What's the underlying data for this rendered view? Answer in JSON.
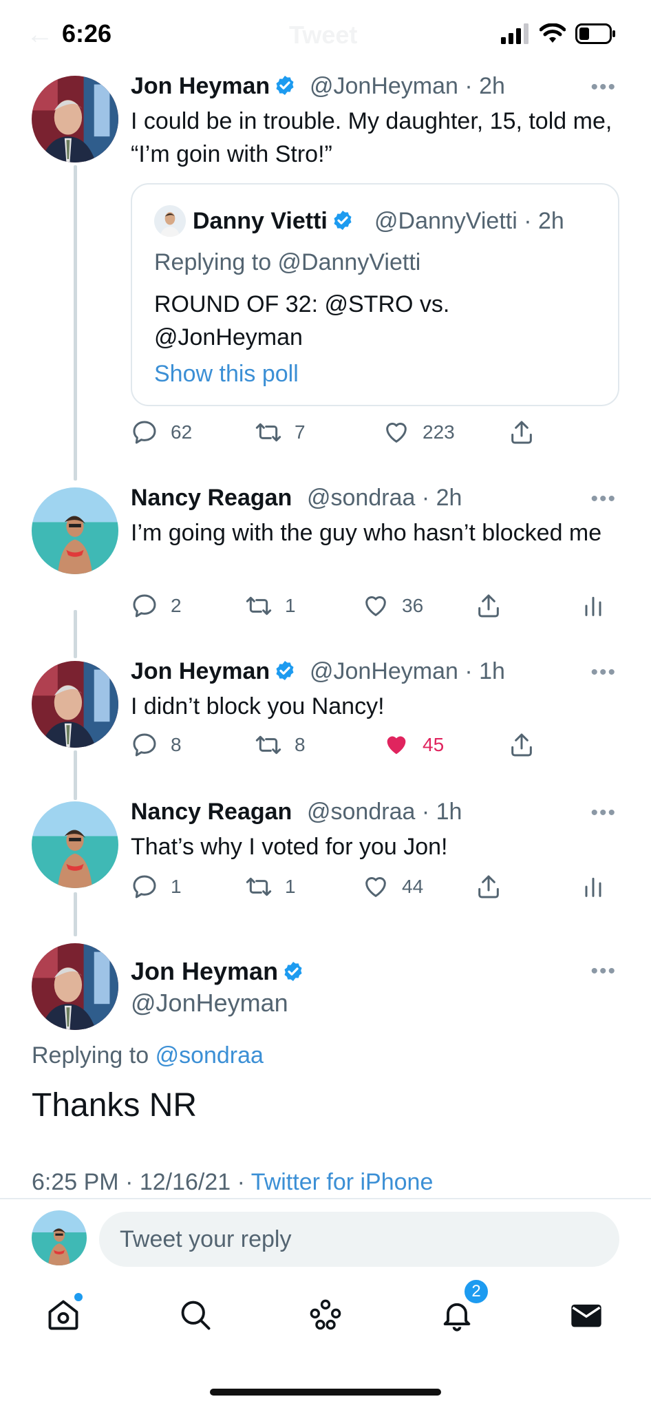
{
  "status_bar": {
    "time": "6:26",
    "ghost_title": "Tweet"
  },
  "tweets": [
    {
      "name": "Jon Heyman",
      "handle_time": "@JonHeyman · 2h",
      "text": "I could be in trouble. My daughter, 15, told me, “I’m goin with Stro!”",
      "quote": {
        "name": "Danny Vietti",
        "handle_time": "@DannyVietti · 2h",
        "replying_to": "Replying to @DannyVietti",
        "text": "ROUND OF 32: @STRO vs. @JonHeyman",
        "link": "Show this poll"
      },
      "replies": "62",
      "retweets": "7",
      "likes": "223"
    },
    {
      "name": "Nancy Reagan",
      "handle_time": "@sondraa · 2h",
      "text": "I’m going with the guy who hasn’t blocked me",
      "replies": "2",
      "retweets": "1",
      "likes": "36"
    },
    {
      "name": "Jon Heyman",
      "handle_time": "@JonHeyman · 1h",
      "text": "I didn’t block you Nancy!",
      "replies": "8",
      "retweets": "8",
      "likes": "45"
    },
    {
      "name": "Nancy Reagan",
      "handle_time": "@sondraa · 1h",
      "text": "That’s why I voted for you Jon!",
      "replies": "1",
      "retweets": "1",
      "likes": "44"
    }
  ],
  "main_tweet": {
    "name": "Jon Heyman",
    "handle": "@JonHeyman",
    "replying_label": "Replying to",
    "replying_mention": "@sondraa",
    "text": "Thanks NR",
    "timestamp": "6:25 PM · 12/16/21 · ",
    "source": "Twitter for iPhone"
  },
  "reply_box": {
    "placeholder": "Tweet your reply"
  },
  "tabbar": {
    "notifications_badge": "2"
  },
  "colors": {
    "link": "#3b8fd5",
    "like_active": "#e0245e",
    "verified": "#1d9bf0"
  }
}
